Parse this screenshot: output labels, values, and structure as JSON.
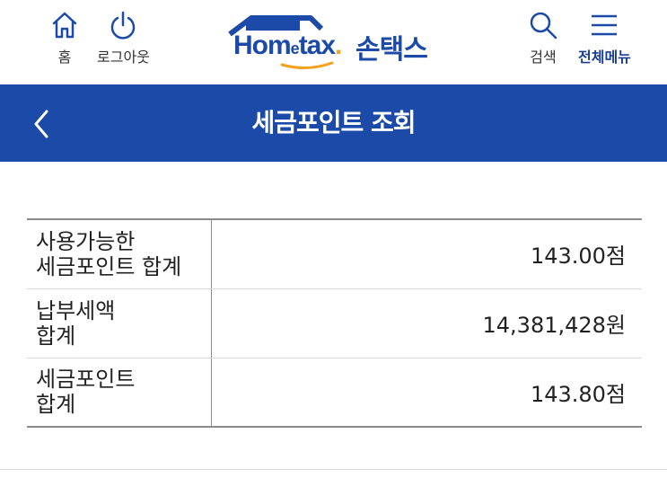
{
  "header": {
    "home_label": "홈",
    "logout_label": "로그아웃",
    "search_label": "검색",
    "menu_label": "전체메뉴",
    "logo_text_main": "Hom",
    "logo_text_e": "e",
    "logo_text_tax": "tax",
    "logo_text_dot": ".",
    "logo_korean": "손택스",
    "brand_color": "#1b4aa8",
    "accent_color": "#f4a11d"
  },
  "titlebar": {
    "title": "세금포인트 조회",
    "back_icon": "chevron-left-icon",
    "background": "#1b4aa8"
  },
  "table": {
    "rows": [
      {
        "label": "사용가능한\n세금포인트 합계",
        "value": "143.00점"
      },
      {
        "label": "납부세액\n합계",
        "value": "14,381,428원"
      },
      {
        "label": "세금포인트\n합계",
        "value": "143.80점"
      }
    ]
  }
}
